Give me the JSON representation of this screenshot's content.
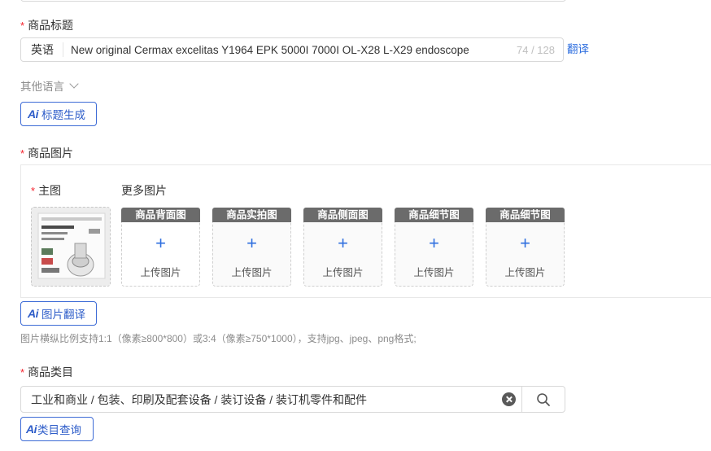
{
  "title_section": {
    "required_mark": "*",
    "label": "商品标题",
    "language": "英语",
    "value": "New original Cermax excelitas Y1964 EPK 5000I 7000I OL-X28 L-X29 endoscope",
    "counter": "74 / 128",
    "translate_link": "翻译",
    "other_languages": "其他语言",
    "ai_button_icon": "Ai",
    "ai_button": "标题生成"
  },
  "images_section": {
    "required_mark": "*",
    "label": "商品图片",
    "main_required_mark": "*",
    "main_label": "主图",
    "more_label": "更多图片",
    "slots": [
      {
        "header": "商品背面图",
        "plus": "+",
        "upload": "上传图片"
      },
      {
        "header": "商品实拍图",
        "plus": "+",
        "upload": "上传图片"
      },
      {
        "header": "商品侧面图",
        "plus": "+",
        "upload": "上传图片"
      },
      {
        "header": "商品细节图",
        "plus": "+",
        "upload": "上传图片"
      },
      {
        "header": "商品细节图",
        "plus": "+",
        "upload": "上传图片"
      }
    ],
    "ai_button_icon": "Ai",
    "ai_button": "图片翻译",
    "hint": "图片横纵比例支持1:1（像素≥800*800）或3:4（像素≥750*1000），支持jpg、jpeg、png格式;"
  },
  "category_section": {
    "required_mark": "*",
    "label": "商品类目",
    "value": "工业和商业 / 包装、印刷及配套设备 / 装订设备 / 装订机零件和配件",
    "ai_button_icon": "Ai",
    "ai_button": "类目查询"
  },
  "colors": {
    "accent": "#2f6fdf",
    "required": "#f5222d",
    "slot_header": "#6b6b6b"
  }
}
